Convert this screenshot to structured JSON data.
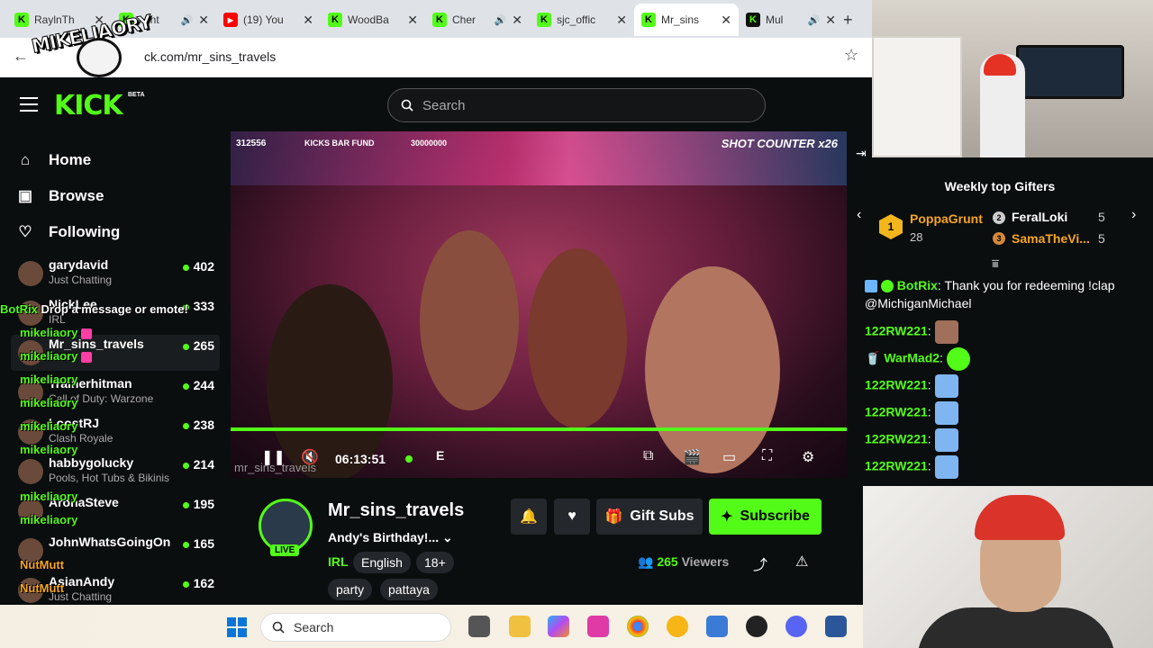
{
  "browser": {
    "tabs": [
      {
        "title": "RaylnTh",
        "icon": "kick-favicon-icon"
      },
      {
        "title": "Mint",
        "icon": "kick-favicon-icon"
      },
      {
        "title": "(19) You",
        "icon": "youtube-favicon-icon"
      },
      {
        "title": "WoodBa",
        "icon": "kick-favicon-icon"
      },
      {
        "title": "Cher",
        "icon": "kick-favicon-icon"
      },
      {
        "title": "sjc_offic",
        "icon": "kick-favicon-icon"
      },
      {
        "title": "Mr_sins",
        "icon": "kick-favicon-icon"
      },
      {
        "title": "Mul",
        "icon": "kick-dark-favicon-icon"
      }
    ],
    "url": "ck.com/mr_sins_travels"
  },
  "overlay": {
    "logo_text": "MIKELIAORY"
  },
  "header": {
    "logo": "KICK",
    "beta": "BETA",
    "search_placeholder": "Search"
  },
  "nav": {
    "home": "Home",
    "browse": "Browse",
    "following": "Following"
  },
  "channels": [
    {
      "name": "garydavid",
      "category": "Just Chatting",
      "viewers": "402"
    },
    {
      "name": "NickLee",
      "category": "IRL",
      "viewers": "333"
    },
    {
      "name": "Mr_sins_travels",
      "category": "",
      "viewers": "265"
    },
    {
      "name": "Trainerhitman",
      "category": "Call of Duty: Warzone",
      "viewers": "244"
    },
    {
      "name": "LoostRJ",
      "category": "Clash Royale",
      "viewers": "238"
    },
    {
      "name": "habbygolucky",
      "category": "Pools, Hot Tubs & Bikinis",
      "viewers": "214"
    },
    {
      "name": "AronaSteve",
      "category": "",
      "viewers": "195"
    },
    {
      "name": "JohnWhatsGoingOn",
      "category": "",
      "viewers": "165"
    },
    {
      "name": "AsianAndy",
      "category": "Just Chatting",
      "viewers": "162"
    }
  ],
  "overlay_chat": [
    {
      "user": "BotRix",
      "msg": "Drop a message or emote!"
    },
    {
      "user": "mikeliaory",
      "msg": ""
    },
    {
      "user": "mikeliaory",
      "msg": ""
    },
    {
      "user": "mikeliaory",
      "msg": ""
    },
    {
      "user": "mikeliaory",
      "msg": ""
    },
    {
      "user": "mikeliaory",
      "msg": ""
    },
    {
      "user": "mikeliaory",
      "msg": ""
    },
    {
      "user": "mikeliaory",
      "msg": ""
    },
    {
      "user": "mikeliaory",
      "msg": ""
    },
    {
      "user": "NutMutt",
      "msg": ""
    },
    {
      "user": "NutMutt",
      "msg": ""
    }
  ],
  "video": {
    "hud_left": "312556",
    "hud_mid": "KICKS BAR FUND",
    "hud_goal": "30000000",
    "shot_counter": "SHOT COUNTER x26",
    "watermark": "mr_sins_travels",
    "time": "06:13:51",
    "live_letter": "E"
  },
  "stream": {
    "name": "Mr_sins_travels",
    "title": "Andy's Birthday!...",
    "live": "LIVE",
    "category": "IRL",
    "tags": [
      "English",
      "18+",
      "party",
      "pattaya"
    ],
    "gift_label": "Gift Subs",
    "subscribe_label": "Subscribe",
    "viewers": "265",
    "viewers_label": "Viewers"
  },
  "gifters": {
    "title": "Weekly top Gifters",
    "top": {
      "rank": "1",
      "name": "PoppaGrunt",
      "count": "28"
    },
    "second": {
      "rank": "2",
      "name": "FeralLoki",
      "count": "5"
    },
    "third": {
      "rank": "3",
      "name": "SamaTheVi...",
      "count": "5"
    }
  },
  "chat": [
    {
      "user": "BotRix",
      "msg": "Thank you for redeeming !clap @MichiganMichael"
    },
    {
      "user": "122RW221",
      "msg": ""
    },
    {
      "user": "WarMad2",
      "msg": ""
    },
    {
      "user": "122RW221",
      "msg": ""
    },
    {
      "user": "122RW221",
      "msg": ""
    },
    {
      "user": "122RW221",
      "msg": ""
    },
    {
      "user": "122RW221",
      "msg": ""
    }
  ],
  "taskbar": {
    "search_placeholder": "Search"
  },
  "colors": {
    "kick_green": "#53fc18",
    "bg": "#0b0e0f",
    "gold": "#f6a623"
  }
}
